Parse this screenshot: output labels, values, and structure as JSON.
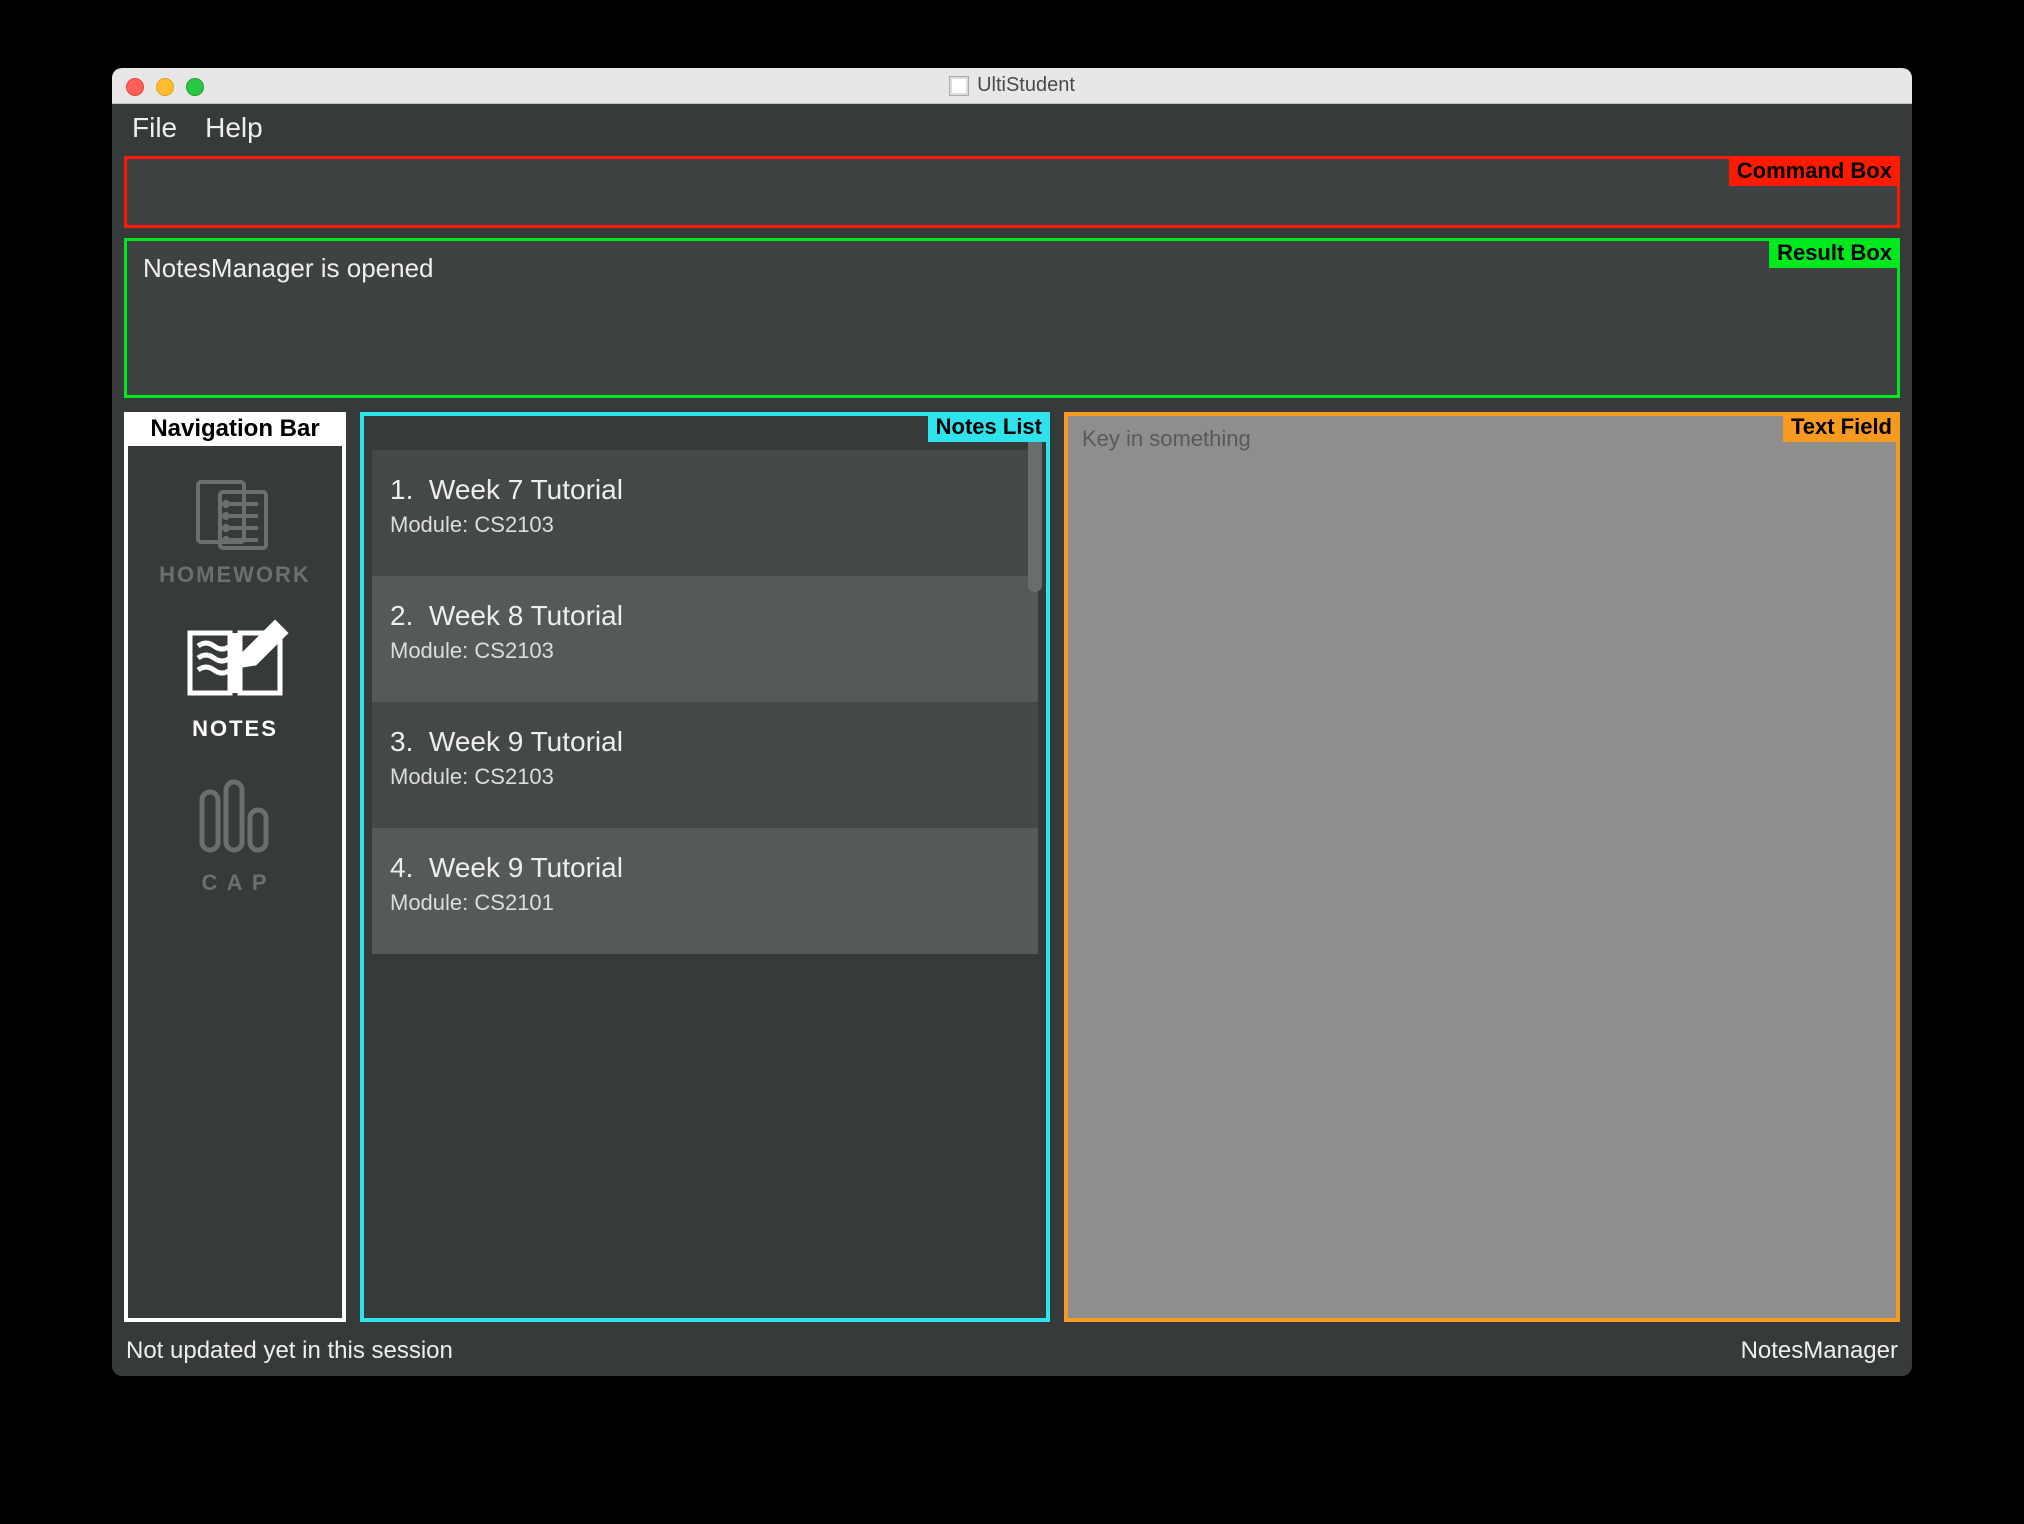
{
  "window": {
    "title": "UltiStudent"
  },
  "menu": {
    "file": "File",
    "help": "Help"
  },
  "annotations": {
    "command_box": "Command Box",
    "result_box": "Result Box",
    "navigation_bar": "Navigation Bar",
    "notes_list": "Notes List",
    "text_field": "Text Field"
  },
  "result": {
    "message": "NotesManager is opened"
  },
  "nav": {
    "items": [
      {
        "label": "HOMEWORK",
        "active": false
      },
      {
        "label": "NOTES",
        "active": true
      },
      {
        "label": "C A P",
        "active": false
      }
    ]
  },
  "notes": {
    "module_prefix": "Module: ",
    "items": [
      {
        "index": "1.",
        "title": "Week 7 Tutorial",
        "module": "CS2103"
      },
      {
        "index": "2.",
        "title": "Week 8 Tutorial",
        "module": "CS2103"
      },
      {
        "index": "3.",
        "title": "Week 9 Tutorial",
        "module": "CS2103"
      },
      {
        "index": "4.",
        "title": "Week 9 Tutorial",
        "module": "CS2101"
      }
    ]
  },
  "textfield": {
    "placeholder": "Key in something"
  },
  "status": {
    "left": "Not updated yet in this session",
    "right": "NotesManager"
  },
  "colors": {
    "command_border": "#ff1a00",
    "result_border": "#00e81e",
    "nav_border": "#ffffff",
    "list_border": "#2fe3ed",
    "textfield_border": "#f79a1f"
  }
}
